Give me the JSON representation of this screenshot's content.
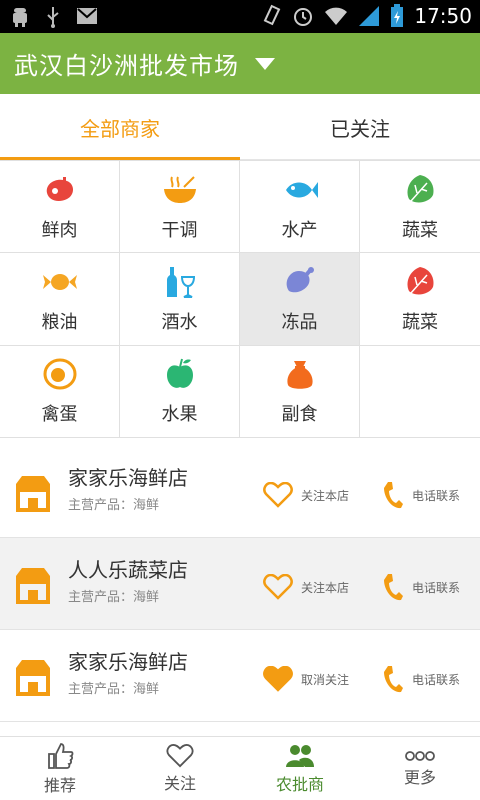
{
  "statusbar": {
    "time": "17:50"
  },
  "header": {
    "title": "武汉白沙洲批发市场"
  },
  "tabs": [
    {
      "label": "全部商家",
      "active": true
    },
    {
      "label": "已关注",
      "active": false
    }
  ],
  "categories": [
    {
      "label": "鲜肉",
      "icon": "meat-icon",
      "color": "#e8453c"
    },
    {
      "label": "干调",
      "icon": "bowl-icon",
      "color": "#f39c12"
    },
    {
      "label": "水产",
      "icon": "fish-icon",
      "color": "#29a9e0"
    },
    {
      "label": "蔬菜",
      "icon": "leaf-icon",
      "color": "#4caf50"
    },
    {
      "label": "粮油",
      "icon": "candy-icon",
      "color": "#f5a623"
    },
    {
      "label": "酒水",
      "icon": "bottle-icon",
      "color": "#29a9e0"
    },
    {
      "label": "冻品",
      "icon": "drumstick-icon",
      "color": "#7b86d6",
      "selected": true
    },
    {
      "label": "蔬菜",
      "icon": "leaf-icon",
      "color": "#e8453c"
    },
    {
      "label": "禽蛋",
      "icon": "egg-icon",
      "color": "#f39c12"
    },
    {
      "label": "水果",
      "icon": "apple-icon",
      "color": "#2bb673"
    },
    {
      "label": "副食",
      "icon": "sack-icon",
      "color": "#f26b1d"
    }
  ],
  "shops": [
    {
      "name": "家家乐海鲜店",
      "products": "主营产品：海鲜",
      "fav_label": "关注本店",
      "favorited": false,
      "call_label": "电话联系"
    },
    {
      "name": "人人乐蔬菜店",
      "products": "主营产品：海鲜",
      "fav_label": "关注本店",
      "favorited": false,
      "call_label": "电话联系"
    },
    {
      "name": "家家乐海鲜店",
      "products": "主营产品：海鲜",
      "fav_label": "取消关注",
      "favorited": true,
      "call_label": "电话联系"
    }
  ],
  "nav": [
    {
      "label": "推荐",
      "icon": "thumbs-up-icon"
    },
    {
      "label": "关注",
      "icon": "heart-icon"
    },
    {
      "label": "农批商",
      "icon": "users-icon",
      "active": true
    },
    {
      "label": "更多",
      "icon": "more-icon"
    }
  ],
  "colors": {
    "accent": "#f39c12",
    "header": "#7cb342",
    "nav_active": "#4a8a2e"
  }
}
